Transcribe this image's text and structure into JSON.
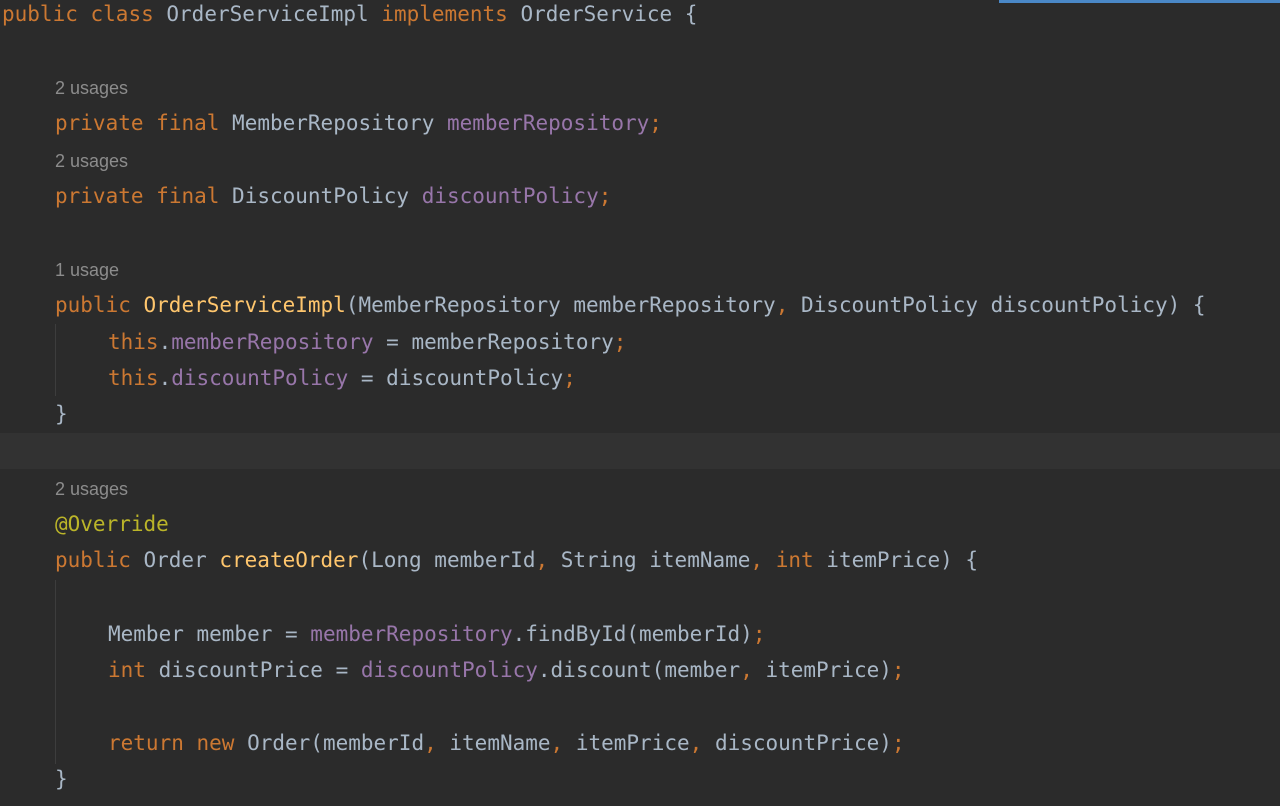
{
  "colors": {
    "background": "#2b2b2b",
    "current_line": "#323232",
    "keyword": "#cc7832",
    "field": "#9876aa",
    "method": "#ffc66d",
    "annotation": "#bbb529",
    "plain": "#a9b7c6",
    "hint": "#8c8c8c",
    "accent": "#4a88c7"
  },
  "hints": {
    "member_repo_usages": "2 usages",
    "discount_policy_usages": "2 usages",
    "constructor_usages": "1 usage",
    "create_order_usages": "2 usages"
  },
  "code": {
    "line1": {
      "public": "public",
      "class": "class",
      "name": "OrderServiceImpl",
      "implements": "implements",
      "iface": "OrderService",
      "brace": " {"
    },
    "line_member_repo": {
      "private": "private",
      "final": "final",
      "type": "MemberRepository",
      "field": "memberRepository",
      "semi": ";"
    },
    "line_discount_policy": {
      "private": "private",
      "final": "final",
      "type": "DiscountPolicy",
      "field": "discountPolicy",
      "semi": ";"
    },
    "constructor": {
      "public": "public",
      "name": "OrderServiceImpl",
      "open": "(MemberRepository memberRepository",
      "comma": ",",
      "rest": " DiscountPolicy discountPolicy) {"
    },
    "assign1": {
      "this": "this",
      "dot": ".",
      "field": "memberRepository",
      "rest": " = memberRepository",
      "semi": ";"
    },
    "assign2": {
      "this": "this",
      "dot": ".",
      "field": "discountPolicy",
      "rest": " = discountPolicy",
      "semi": ";"
    },
    "close_brace": "}",
    "override": "@Override",
    "create_order": {
      "public": "public",
      "type": " Order ",
      "name": "createOrder",
      "p1": "(Long memberId",
      "c1": ",",
      "p2": " String itemName",
      "c2": ",",
      "int": " int",
      "p3": " itemPrice) {"
    },
    "member_line": {
      "decl": "Member member = ",
      "field": "memberRepository",
      "call": ".findById(memberId)",
      "semi": ";"
    },
    "discount_line": {
      "int": "int",
      "decl": " discountPrice = ",
      "field": "discountPolicy",
      "call": ".discount(member",
      "comma": ",",
      "args": " itemPrice)",
      "semi": ";"
    },
    "return_line": {
      "return": "return",
      "new": " new",
      "ctor": " Order(memberId",
      "c1": ",",
      "a2": " itemName",
      "c2": ",",
      "a3": " itemPrice",
      "c3": ",",
      "a4": " discountPrice)",
      "semi": ";"
    },
    "close_brace_2": "}"
  }
}
